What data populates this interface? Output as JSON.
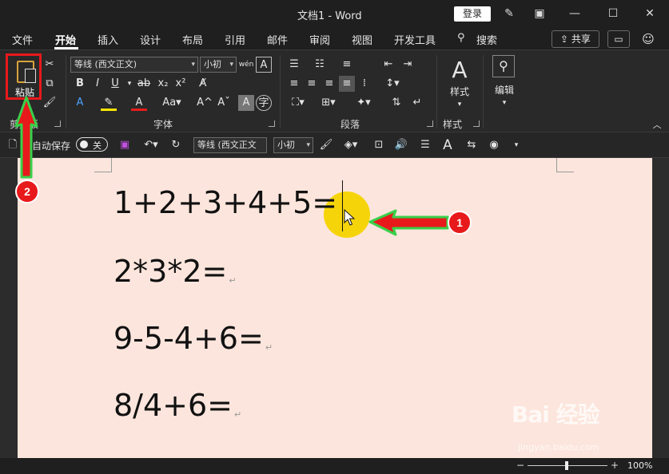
{
  "window": {
    "doc_title": "文档1  -  Word",
    "login_label": "登录"
  },
  "menu": {
    "tabs": [
      "文件",
      "开始",
      "插入",
      "设计",
      "布局",
      "引用",
      "邮件",
      "审阅",
      "视图",
      "开发工具",
      "搜索"
    ],
    "active_tab": "开始",
    "share_label": "共享"
  },
  "ribbon": {
    "paste_label": "粘贴",
    "font_name": "等线 (西文正文)",
    "font_size": "小初",
    "groups": {
      "clipboard": "剪贴板",
      "font": "字体",
      "paragraph": "段落",
      "styles": "样式"
    },
    "styles_btn": "样式",
    "edit_btn": "编辑"
  },
  "qat": {
    "autosave_label": "自动保存",
    "autosave_state": "关",
    "font_name": "等线 (西文正文",
    "font_size": "小初"
  },
  "document": {
    "lines": [
      "1+2+3+4+5=",
      "2*3*2=",
      "9-5-4+6=",
      "8/4+6="
    ],
    "paragraph_mark": "↵"
  },
  "status": {
    "zoom": "100%",
    "zoom_level": 100
  },
  "annotations": {
    "badge_1": "1",
    "badge_2": "2",
    "accent_red": "#e8191b",
    "accent_green": "#39d04a"
  },
  "watermark": {
    "logo": "Bai 经验",
    "url": "jingyan.baidu.com"
  }
}
